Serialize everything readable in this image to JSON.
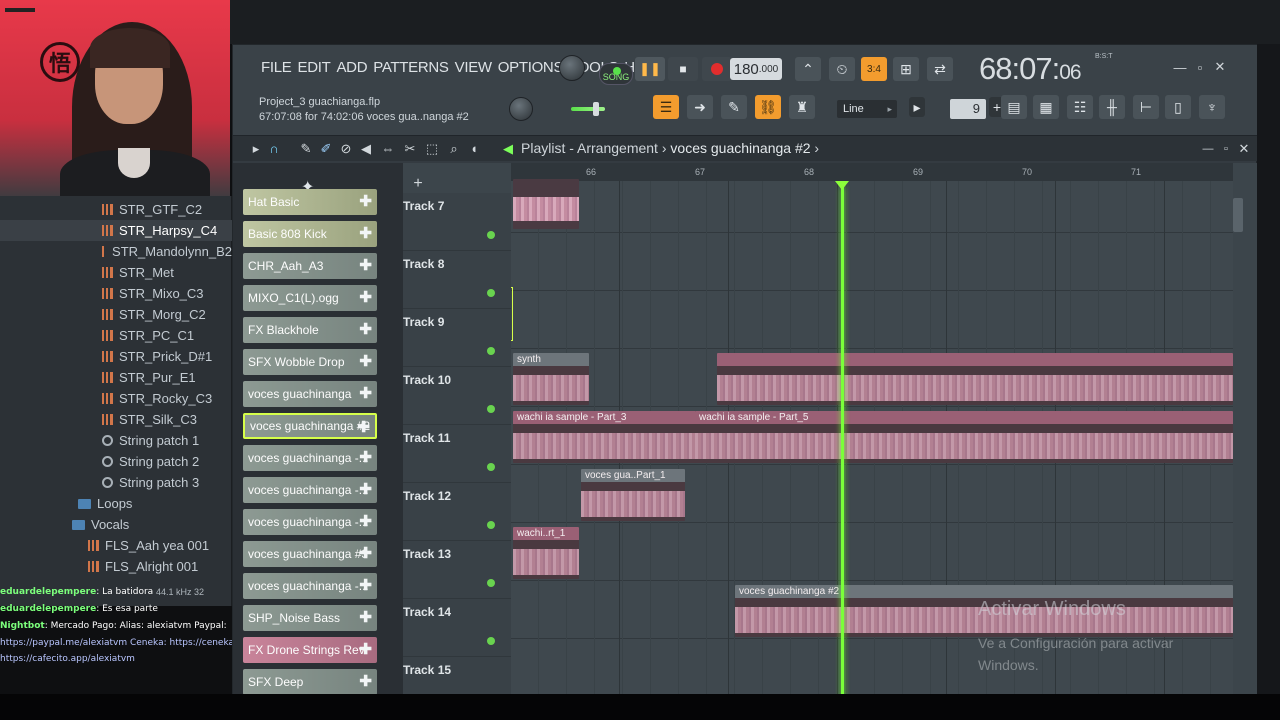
{
  "menu": {
    "items": [
      "FILE",
      "EDIT",
      "ADD",
      "PATTERNS",
      "VIEW",
      "OPTIONS",
      "TOOLS",
      "HELP"
    ]
  },
  "project": {
    "file": "Project_3 guachianga.flp",
    "hint": "67:07:08 for 74:02:06 voces gua..nanga #2"
  },
  "transport": {
    "mode": "SONG",
    "tempo": "180",
    "tempo_dec": ".000",
    "time_main": "68:07:",
    "time_sub": "06",
    "time_label": "B:S:T",
    "pattern_overlay": "3:4"
  },
  "snap": {
    "mode": "Line",
    "value": "9"
  },
  "playlist": {
    "title": "Playlist - Arrangement",
    "arrow": "›",
    "pattern": "voces guachinanga #2"
  },
  "browser": {
    "items": [
      {
        "label": "STR_GTF_C2",
        "icon": "waveform-icon"
      },
      {
        "label": "STR_Harpsy_C4",
        "icon": "waveform-icon",
        "selected": true
      },
      {
        "label": "STR_Mandolynn_B2",
        "icon": "waveform-icon"
      },
      {
        "label": "STR_Met",
        "icon": "waveform-icon"
      },
      {
        "label": "STR_Mixo_C3",
        "icon": "waveform-icon"
      },
      {
        "label": "STR_Morg_C2",
        "icon": "waveform-icon"
      },
      {
        "label": "STR_PC_C1",
        "icon": "waveform-icon"
      },
      {
        "label": "STR_Prick_D#1",
        "icon": "waveform-icon"
      },
      {
        "label": "STR_Pur_E1",
        "icon": "waveform-icon"
      },
      {
        "label": "STR_Rocky_C3",
        "icon": "waveform-icon"
      },
      {
        "label": "STR_Silk_C3",
        "icon": "waveform-icon"
      },
      {
        "label": "String patch 1",
        "icon": "gear-icon"
      },
      {
        "label": "String patch 2",
        "icon": "gear-icon"
      },
      {
        "label": "String patch 3",
        "icon": "gear-icon"
      },
      {
        "label": "Loops",
        "icon": "folder-icon"
      },
      {
        "label": "Vocals",
        "icon": "folder-icon"
      },
      {
        "label": "FLS_Aah yea 001",
        "icon": "waveform-icon"
      },
      {
        "label": "FLS_Alright 001",
        "icon": "waveform-icon"
      }
    ],
    "status": "44.1 kHz 32"
  },
  "channels": [
    {
      "label": "Hat Basic",
      "style": "amber"
    },
    {
      "label": "Basic 808 Kick",
      "style": "amber"
    },
    {
      "label": "CHR_Aah_A3",
      "style": "normal"
    },
    {
      "label": "MIXO_C1(L).ogg",
      "style": "normal"
    },
    {
      "label": "FX Blackhole",
      "style": "normal"
    },
    {
      "label": "SFX Wobble Drop",
      "style": "normal"
    },
    {
      "label": "voces guachinanga",
      "style": "normal"
    },
    {
      "label": "voces guachinanga #2",
      "style": "normal",
      "selected": true
    },
    {
      "label": "voces guachinanga -...",
      "style": "normal"
    },
    {
      "label": "voces guachinanga -...",
      "style": "normal"
    },
    {
      "label": "voces guachinanga -...",
      "style": "normal"
    },
    {
      "label": "voces guachinanga #3",
      "style": "normal"
    },
    {
      "label": "voces guachinanga -...",
      "style": "normal"
    },
    {
      "label": "SHP_Noise Bass",
      "style": "normal"
    },
    {
      "label": "FX Drone Strings Rev",
      "style": "pink"
    },
    {
      "label": "SFX Deep",
      "style": "normal"
    }
  ],
  "tracks": [
    "Track 7",
    "Track 8",
    "Track 9",
    "Track 10",
    "Track 11",
    "Track 12",
    "Track 13",
    "Track 14",
    "Track 15"
  ],
  "ruler": [
    "66",
    "67",
    "68",
    "69",
    "70",
    "71"
  ],
  "clips": {
    "synth": "synth",
    "wachi3": "wachi ia sample - Part_3",
    "wachi5": "wachi ia sample - Part_5",
    "voces1": "voces gua..Part_1",
    "wachirt": "wachi..rt_1",
    "voces2": "voces guachinanga #2"
  },
  "chat": [
    {
      "user": "eduardelepempere",
      "text": ": La batidora"
    },
    {
      "user": "eduardelepempere",
      "text": ": Es esa parte"
    },
    {
      "user": "Nightbot",
      "text": ": Mercado Pago: Alias: alexiatvm Paypal:"
    },
    {
      "user": "",
      "text": "https://paypal.me/alexiatvm Ceneka: https://ceneka.net/alexiatvm Cafecito:"
    },
    {
      "user": "",
      "text": "https://cafecito.app/alexiatvm"
    }
  ],
  "watermark": {
    "title": "Activar Windows",
    "line1": "Ve a Configuración para activar",
    "line2": "Windows."
  },
  "webcam": {
    "logo": "悟"
  }
}
